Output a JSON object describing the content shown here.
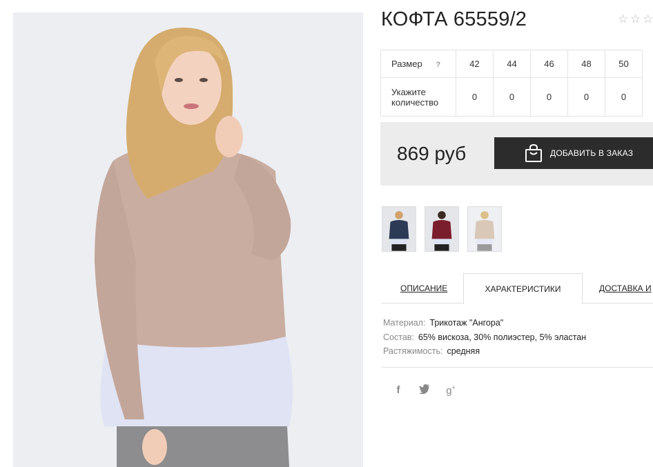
{
  "product": {
    "title": "КОФТА 65559/2",
    "rating_icons": [
      "star-outline-icon",
      "star-outline-icon",
      "star-outline-icon"
    ]
  },
  "sizes": {
    "size_label": "Размер",
    "help_label": "?",
    "qty_label": "Укажите количество",
    "values": [
      "42",
      "44",
      "46",
      "48",
      "50"
    ],
    "quantities": [
      "0",
      "0",
      "0",
      "0",
      "0"
    ]
  },
  "purchase": {
    "price": "869 руб",
    "add_button": "ДОБАВИТЬ В ЗАКАЗ",
    "button_icon": "shopping-bag-icon"
  },
  "thumbnails": [
    {
      "name": "navy-sweater",
      "color": "#2d3a55"
    },
    {
      "name": "burgundy-sweater",
      "color": "#7a1e2e"
    },
    {
      "name": "beige-sweater",
      "color": "#d9c7b8"
    }
  ],
  "tabs": [
    {
      "label": "ОПИСАНИЕ"
    },
    {
      "label": "ХАРАКТЕРИСТИКИ"
    },
    {
      "label": "ДОСТАВКА И"
    }
  ],
  "characteristics": [
    {
      "key": "Материал:",
      "value": "Трикотаж \"Ангора\""
    },
    {
      "key": "Состав:",
      "value": "65% вискоза, 30% полиэстер, 5% эластан"
    },
    {
      "key": "Растяжимость:",
      "value": "средняя"
    }
  ],
  "social": [
    {
      "icon": "facebook-icon",
      "glyph": "f"
    },
    {
      "icon": "twitter-icon",
      "glyph": "🐦"
    },
    {
      "icon": "google-plus-icon",
      "glyph": "g+"
    }
  ],
  "colors": {
    "button_bg": "#2c2c2c",
    "panel_bg": "#ececec",
    "sweater": "#c9ada0"
  }
}
